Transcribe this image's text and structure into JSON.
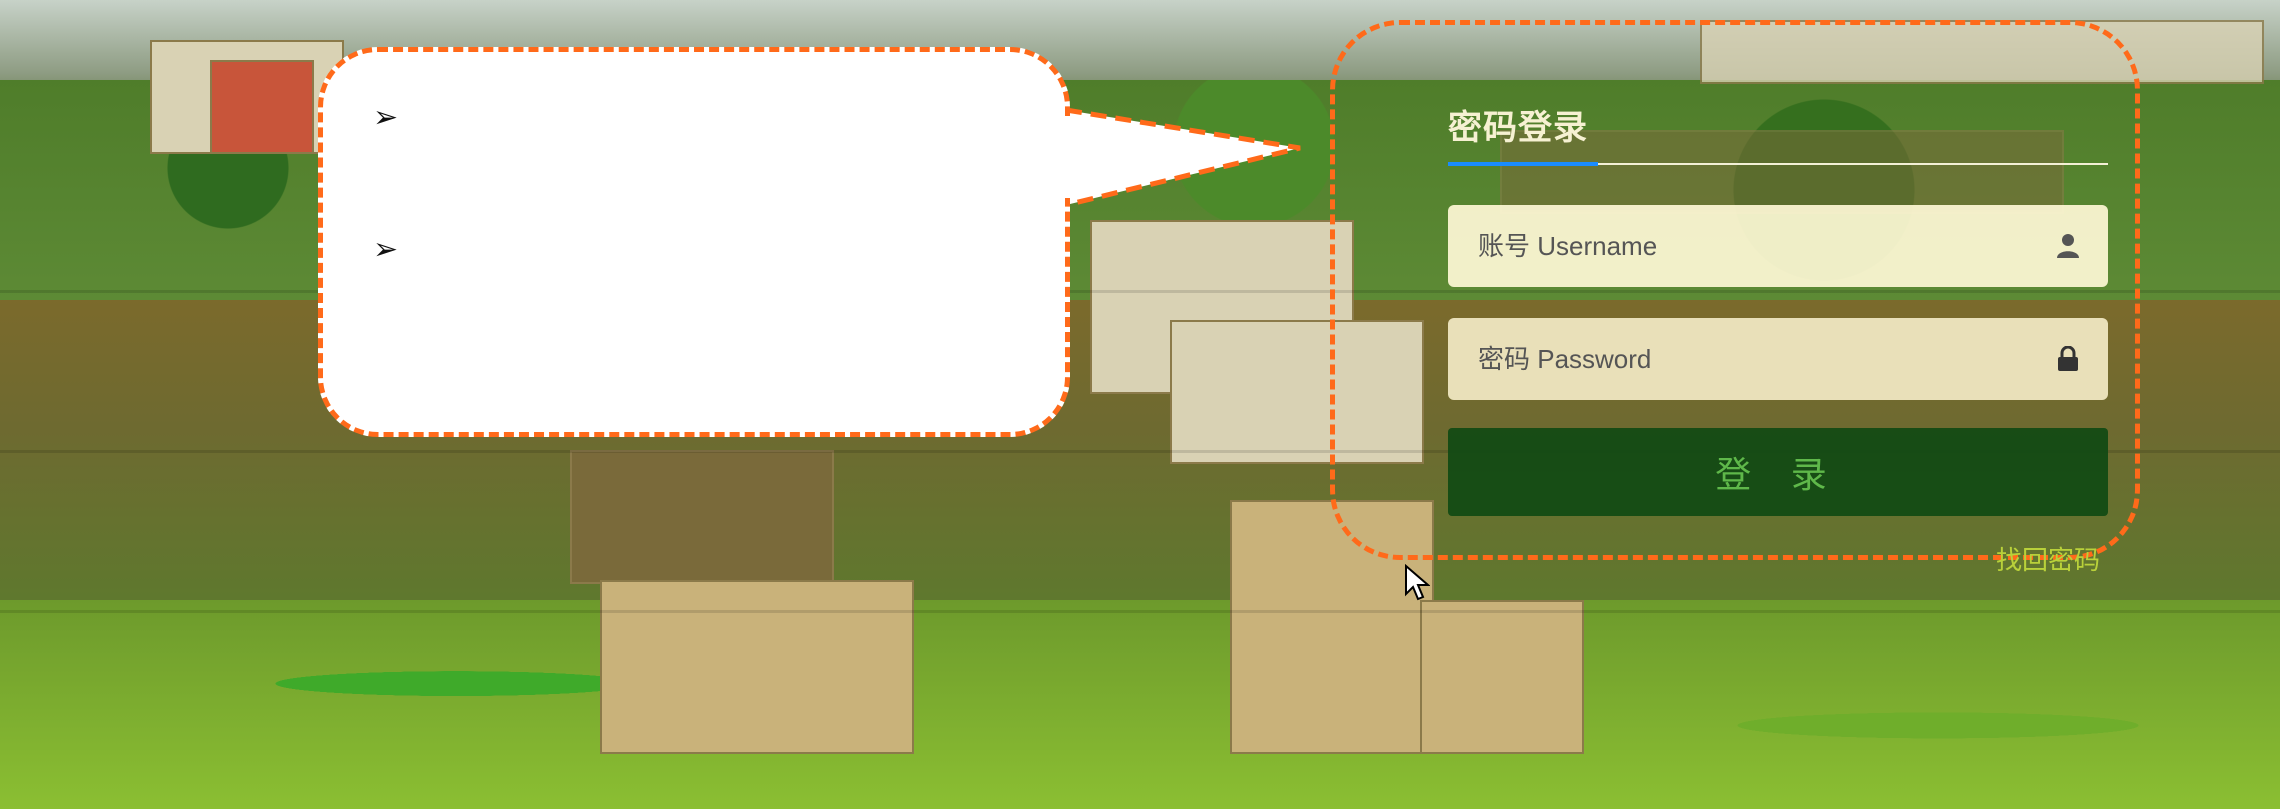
{
  "login": {
    "title": "密码登录",
    "username_placeholder": "账号 Username",
    "password_placeholder": "密码 Password",
    "submit_label": "登 录",
    "forgot_link": "找回密码"
  },
  "callout": {
    "bullets": [
      "➢",
      "➢"
    ]
  },
  "colors": {
    "highlight": "#ff6a1a",
    "button_bg": "#104a14",
    "button_text": "#5fb84a",
    "title_text": "#f6f1d2",
    "tab_underline": "#1a8cff",
    "forgot_text": "#b9d13a"
  },
  "icons": {
    "username": "user-icon",
    "password": "lock-icon",
    "cursor": "mouse-pointer-icon"
  }
}
